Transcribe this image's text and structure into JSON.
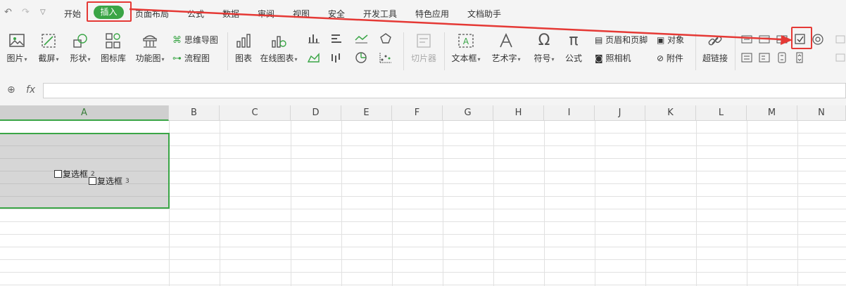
{
  "tabs": [
    "开始",
    "插入",
    "页面布局",
    "公式",
    "数据",
    "审阅",
    "视图",
    "安全",
    "开发工具",
    "特色应用",
    "文档助手"
  ],
  "ribbon": {
    "picture": "图片",
    "screenshot": "截屏",
    "shape": "形状",
    "icon_lib": "图标库",
    "func_chart": "功能图",
    "mind_map": "思维导图",
    "flowchart": "流程图",
    "chart": "图表",
    "online_chart": "在线图表",
    "slicer": "切片器",
    "textbox": "文本框",
    "wordart": "艺术字",
    "symbol": "符号",
    "formula": "公式",
    "header_footer": "页眉和页脚",
    "object": "对象",
    "camera": "照相机",
    "attachment": "附件",
    "hyperlink": "超链接"
  },
  "formula_bar": {
    "fx": "fx",
    "value": ""
  },
  "columns": [
    "A",
    "B",
    "C",
    "D",
    "E",
    "F",
    "G",
    "H",
    "I",
    "J",
    "K",
    "L",
    "M",
    "N"
  ],
  "checkboxes": [
    {
      "label": "复选框",
      "num": "2"
    },
    {
      "label": "复选框",
      "num": "3"
    }
  ],
  "colors": {
    "accent": "#3aa546",
    "highlight": "#e53935",
    "selection": "#d6d6d6"
  }
}
